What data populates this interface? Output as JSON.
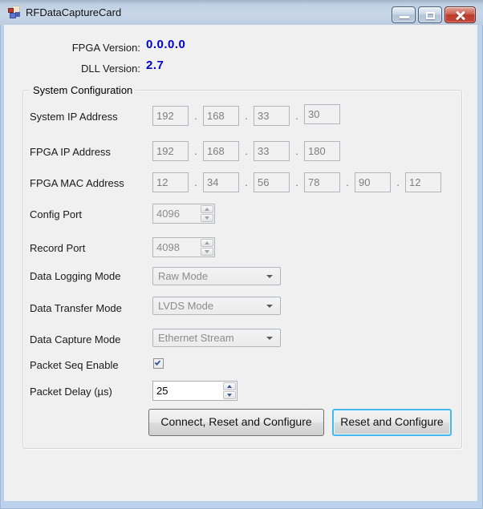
{
  "window": {
    "title": "RFDataCaptureCard"
  },
  "versions": {
    "fpga": {
      "label": "FPGA Version:",
      "value": "0.0.0.0"
    },
    "dll": {
      "label": "DLL Version:",
      "value": "2.7"
    }
  },
  "group": {
    "title": "System Configuration"
  },
  "separator": ".",
  "fields": {
    "system_ip": {
      "label": "System IP Address",
      "octets": [
        "192",
        "168",
        "33",
        "30"
      ],
      "enabled": false
    },
    "fpga_ip": {
      "label": "FPGA IP Address",
      "octets": [
        "192",
        "168",
        "33",
        "180"
      ],
      "enabled": false
    },
    "fpga_mac": {
      "label": "FPGA MAC Address",
      "octets": [
        "12",
        "34",
        "56",
        "78",
        "90",
        "12"
      ],
      "enabled": false
    },
    "config_port": {
      "label": "Config Port",
      "value": "4096",
      "enabled": false
    },
    "record_port": {
      "label": "Record Port",
      "value": "4098",
      "enabled": false
    },
    "data_logging_mode": {
      "label": "Data Logging Mode",
      "value": "Raw Mode",
      "enabled": false
    },
    "data_transfer_mode": {
      "label": "Data Transfer Mode",
      "value": "LVDS Mode",
      "enabled": false
    },
    "data_capture_mode": {
      "label": "Data Capture Mode",
      "value": "Ethernet Stream",
      "enabled": false
    },
    "packet_seq_enable": {
      "label": "Packet Seq Enable",
      "checked": true
    },
    "packet_delay": {
      "label": "Packet Delay (µs)",
      "value": "25",
      "enabled": true
    }
  },
  "buttons": {
    "connect_reset_configure": {
      "label": "Connect, Reset and Configure"
    },
    "reset_configure": {
      "label": "Reset and Configure",
      "focused": true
    }
  },
  "colors": {
    "version_value": "#0000CD",
    "client_background": "#F0F0F0",
    "window_frame": "#BCD2EC",
    "focused_button_border": "#43B9F0",
    "close_button": "#C6473A",
    "check_mark": "#3C5BA8"
  }
}
